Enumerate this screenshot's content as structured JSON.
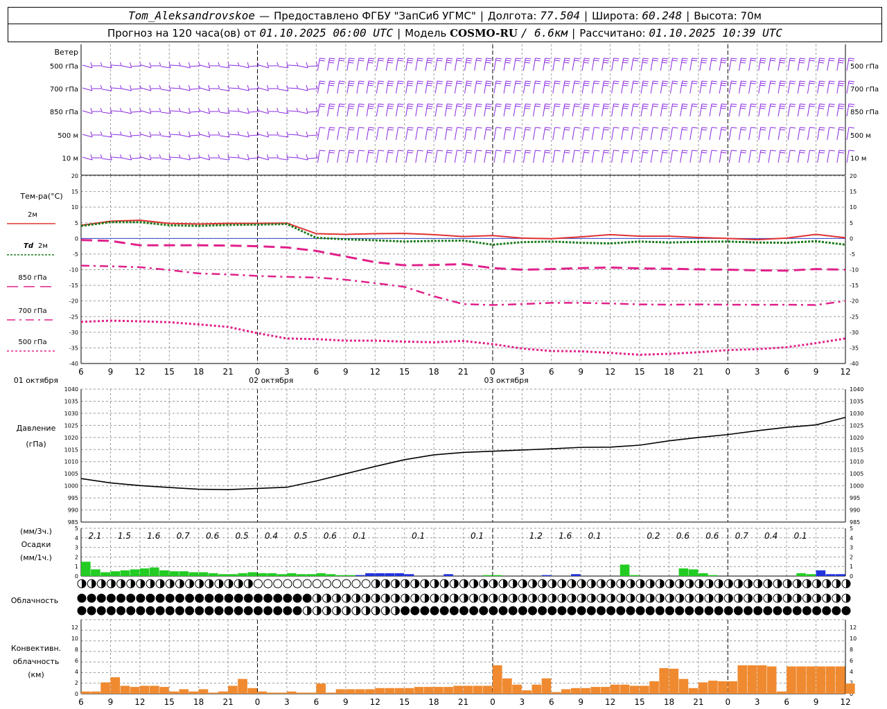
{
  "header": {
    "station": "Tom_Aleksandrovskoe",
    "dash": "—",
    "provider": "Предоставлено ФГБУ \"ЗапСиб УГМС\"",
    "lon_label": "Долгота:",
    "lon_value": "77.504",
    "lat_label": "Широта:",
    "lat_value": "60.248",
    "alt_label": "Высота:",
    "alt_value": "70м",
    "forecast_prefix": "Прогноз на 120 часа(ов) от",
    "forecast_time": "01.10.2025 06:00 UTC",
    "model_label": "Модель",
    "model_name": "COSMO-RU",
    "model_res": "/ 6.6км",
    "calc_label": "Рассчитано:",
    "calc_time": "01.10.2025 10:39 UTC"
  },
  "wind_panel": {
    "title": "Ветер",
    "levels": [
      "500 гПа",
      "700 гПа",
      "850 гПа",
      "500 м",
      "10 м"
    ],
    "barb_color": "#8a2be2"
  },
  "temp_panel": {
    "title": "Тем-ра(°C)",
    "legend": [
      {
        "label": "2м",
        "color": "#e03030",
        "dash": ""
      },
      {
        "label_italic": "Td",
        "label": "2м",
        "color": "#1a7a1a",
        "dash": "3,2"
      },
      {
        "label": "850 гПа",
        "color": "#e0208a",
        "dash": "16,8"
      },
      {
        "label": "700 гПа",
        "color": "#e0208a",
        "dash": "12,6,3,6"
      },
      {
        "label": "500 гПа",
        "color": "#e0208a",
        "dash": "3,3"
      }
    ],
    "y_ticks": [
      20,
      15,
      10,
      5,
      0,
      -5,
      -10,
      -15,
      -20,
      -25,
      -30,
      -35,
      -40
    ]
  },
  "time_axis": {
    "hour_labels": [
      "6",
      "9",
      "12",
      "15",
      "18",
      "21",
      "0",
      "3",
      "6",
      "9",
      "12",
      "15",
      "18",
      "21",
      "0",
      "3",
      "6",
      "9",
      "12",
      "15",
      "18",
      "21",
      "0",
      "3",
      "6",
      "9",
      "12"
    ],
    "dates": [
      "01 октября",
      "02 октября",
      "03 октября"
    ]
  },
  "pressure_panel": {
    "title": "Давление",
    "unit": "(гПа)",
    "y_ticks": [
      1040,
      1035,
      1030,
      1025,
      1020,
      1015,
      1010,
      1005,
      1000,
      995,
      990,
      985
    ],
    "color": "#000000"
  },
  "precip_panel": {
    "unit_top": "(мм/3ч.)",
    "title": "Осадки",
    "unit_bottom": "(мм/1ч.)",
    "y_ticks": [
      5,
      4,
      3,
      2,
      1,
      0
    ],
    "amounts_3h": [
      "2.1",
      "1.5",
      "1.6",
      "0.7",
      "0.6",
      "0.5",
      "0.4",
      "0.5",
      "0.6",
      "0.1",
      "0.1",
      "0.1",
      "1.2",
      "1.6",
      "0.1",
      "0.2",
      "0.6",
      "0.6",
      "0.7",
      "0.4",
      "0.1"
    ],
    "rain_color": "#22cc22",
    "snow_color": "#2233dd"
  },
  "cloud_panel": {
    "title": "Облачность"
  },
  "conv_panel": {
    "title1": "Конвективн.",
    "title2": "облачность",
    "unit": "(км)",
    "y_ticks": [
      12,
      10,
      8,
      6,
      4,
      2,
      0
    ],
    "color": "#f08a30"
  },
  "chart_data": [
    {
      "type": "line",
      "title": "Тем-ра(°C)",
      "x_hours": [
        0,
        3,
        6,
        9,
        12,
        15,
        18,
        21,
        24,
        27,
        30,
        33,
        36,
        39,
        42,
        45,
        48,
        51,
        54,
        57,
        60,
        63,
        66,
        69,
        72,
        75,
        78
      ],
      "ylim": [
        -40,
        20
      ],
      "series": [
        {
          "name": "2м",
          "values": [
            4.2,
            5.5,
            5.8,
            4.8,
            4.6,
            4.8,
            4.8,
            4.9,
            1.5,
            1.3,
            1.5,
            1.6,
            1.2,
            0.6,
            0.9,
            0.1,
            -0.1,
            0.5,
            1.2,
            0.7,
            0.7,
            0.3,
            0.0,
            -0.4,
            0.1,
            1.3,
            0.2
          ]
        },
        {
          "name": "Td 2м",
          "values": [
            4.0,
            5.2,
            5.2,
            4.2,
            4.0,
            4.3,
            4.4,
            4.6,
            0.2,
            -0.3,
            -0.6,
            -1.0,
            -0.8,
            -0.7,
            -2.0,
            -1.2,
            -1.0,
            -1.4,
            -1.6,
            -1.0,
            -1.3,
            -1.1,
            -1.0,
            -1.3,
            -1.4,
            -0.9,
            -2.0
          ]
        },
        {
          "name": "850 гПа",
          "values": [
            -0.5,
            -0.8,
            -2.2,
            -2.2,
            -2.2,
            -2.3,
            -2.5,
            -2.9,
            -4.0,
            -5.8,
            -7.6,
            -8.6,
            -8.5,
            -8.2,
            -9.5,
            -10.0,
            -9.8,
            -9.5,
            -9.3,
            -9.6,
            -9.7,
            -9.9,
            -10.0,
            -10.2,
            -10.3,
            -9.8,
            -10.0
          ]
        },
        {
          "name": "700 гПа",
          "values": [
            -8.7,
            -8.9,
            -9.2,
            -10.1,
            -11.2,
            -11.5,
            -12.0,
            -12.3,
            -12.5,
            -13.2,
            -14.3,
            -15.5,
            -18.5,
            -21.0,
            -21.3,
            -21.0,
            -20.6,
            -20.6,
            -20.8,
            -21.1,
            -21.2,
            -21.1,
            -21.2,
            -21.2,
            -21.2,
            -21.3,
            -20.0
          ]
        },
        {
          "name": "500 гПа",
          "values": [
            -26.7,
            -26.3,
            -26.5,
            -26.8,
            -27.5,
            -28.3,
            -30.3,
            -32.0,
            -32.2,
            -32.7,
            -32.7,
            -33.0,
            -33.2,
            -32.8,
            -33.8,
            -35.2,
            -36.0,
            -36.1,
            -36.6,
            -37.2,
            -36.9,
            -36.4,
            -35.7,
            -35.4,
            -34.8,
            -33.5,
            -32.0
          ]
        }
      ]
    },
    {
      "type": "line",
      "title": "Давление",
      "ylabel": "(гПа)",
      "x_hours": [
        0,
        3,
        6,
        9,
        12,
        15,
        18,
        21,
        24,
        27,
        30,
        33,
        36,
        39,
        42,
        45,
        48,
        51,
        54,
        57,
        60,
        63,
        66,
        69,
        72,
        75,
        78
      ],
      "ylim": [
        985,
        1040
      ],
      "series": [
        {
          "name": "Давление",
          "values": [
            1003.0,
            1001.2,
            1000.1,
            999.3,
            998.6,
            998.4,
            998.9,
            999.4,
            1002.0,
            1005.0,
            1008.0,
            1010.8,
            1012.8,
            1013.8,
            1014.3,
            1014.8,
            1015.3,
            1015.9,
            1016.0,
            1016.8,
            1018.6,
            1020.0,
            1021.2,
            1022.8,
            1024.2,
            1025.2,
            1028.3
          ]
        }
      ]
    },
    {
      "type": "bar",
      "title": "Осадки",
      "ylabel": "(мм/1ч.)",
      "ylim": [
        0,
        5
      ],
      "x_hours": [
        0,
        1,
        2,
        3,
        4,
        5,
        6,
        7,
        8,
        9,
        10,
        11,
        12,
        13,
        14,
        15,
        16,
        17,
        18,
        19,
        20,
        21,
        22,
        23,
        24,
        25,
        26,
        27,
        28,
        29,
        30,
        31,
        32,
        33,
        34,
        35,
        36,
        37,
        38,
        39,
        40,
        41,
        42,
        43,
        44,
        45,
        46,
        47,
        48,
        49,
        50,
        51,
        52,
        53,
        54,
        55,
        56,
        57,
        58,
        59,
        60,
        61,
        62,
        63,
        64,
        65,
        66,
        67,
        68,
        69,
        70,
        71,
        72,
        73,
        74,
        75,
        76,
        77,
        78
      ],
      "series": [
        {
          "name": "rain",
          "values": [
            1.5,
            0.7,
            0.4,
            0.5,
            0.6,
            0.7,
            0.8,
            0.9,
            0.6,
            0.5,
            0.5,
            0.4,
            0.4,
            0.3,
            0.2,
            0.2,
            0.3,
            0.4,
            0.3,
            0.3,
            0.2,
            0.3,
            0.2,
            0.2,
            0.3,
            0.2,
            0.1,
            0.1,
            0.1,
            0.2,
            0.2,
            0.2,
            0.2,
            0.1,
            0,
            0,
            0,
            0,
            0,
            0,
            0,
            0.1,
            0.1,
            0,
            0,
            0,
            0,
            0,
            0,
            0,
            0,
            0,
            0,
            0,
            0,
            1.2,
            0.1,
            0,
            0,
            0,
            0,
            0.8,
            0.7,
            0.3,
            0.1,
            0,
            0,
            0,
            0,
            0,
            0,
            0,
            0,
            0.3,
            0.2,
            0.1,
            0.1,
            0.1,
            0
          ]
        },
        {
          "name": "snow",
          "values": [
            0,
            0,
            0,
            0,
            0,
            0,
            0,
            0,
            0,
            0,
            0,
            0,
            0,
            0,
            0,
            0,
            0,
            0,
            0,
            0,
            0,
            0,
            0,
            0,
            0,
            0,
            0,
            0,
            0.1,
            0.3,
            0.3,
            0.3,
            0.3,
            0.2,
            0,
            0,
            0,
            0.2,
            0,
            0,
            0,
            0,
            0,
            0,
            0,
            0,
            0,
            0.1,
            0,
            0,
            0.2,
            0,
            0,
            0,
            0,
            0,
            0,
            0,
            0,
            0,
            0,
            0,
            0,
            0,
            0,
            0,
            0,
            0,
            0,
            0,
            0,
            0,
            0,
            0,
            0,
            0.6,
            0.2,
            0.2,
            0
          ]
        }
      ]
    },
    {
      "type": "bar",
      "title": "Конвективн. облачность",
      "ylabel": "(км)",
      "ylim": [
        0,
        13
      ],
      "x_hours": [
        0,
        1,
        2,
        3,
        4,
        5,
        6,
        7,
        8,
        9,
        10,
        11,
        12,
        13,
        14,
        15,
        16,
        17,
        18,
        19,
        20,
        21,
        22,
        23,
        24,
        25,
        26,
        27,
        28,
        29,
        30,
        31,
        32,
        33,
        34,
        35,
        36,
        37,
        38,
        39,
        40,
        41,
        42,
        43,
        44,
        45,
        46,
        47,
        48,
        49,
        50,
        51,
        52,
        53,
        54,
        55,
        56,
        57,
        58,
        59,
        60,
        61,
        62,
        63,
        64,
        65,
        66,
        67,
        68,
        69,
        70,
        71,
        72,
        73,
        74,
        75,
        76,
        77,
        78
      ],
      "series": [
        {
          "name": "top",
          "values": [
            0.4,
            0.4,
            2.0,
            2.9,
            1.4,
            1.2,
            1.4,
            1.4,
            1.2,
            0.4,
            0.8,
            0.4,
            0.8,
            0.2,
            0.4,
            1.4,
            2.6,
            1.0,
            0.4,
            0.2,
            0.2,
            0.4,
            0.2,
            0.2,
            1.8,
            0.2,
            0.8,
            0.8,
            0.8,
            0.8,
            1.0,
            1.0,
            1.0,
            1.0,
            1.2,
            1.2,
            1.2,
            1.2,
            1.4,
            1.4,
            1.4,
            1.4,
            5.0,
            2.7,
            1.6,
            0.6,
            1.6,
            2.7,
            0.3,
            0.8,
            1.0,
            1.0,
            1.2,
            1.2,
            1.6,
            1.6,
            1.4,
            1.4,
            2.2,
            4.5,
            4.4,
            2.6,
            1.0,
            2.0,
            2.3,
            2.2,
            2.2,
            5.0,
            5.0,
            5.0,
            4.8,
            0.4,
            4.8,
            4.8,
            4.8,
            4.8,
            4.8,
            4.8,
            1.8
          ]
        }
      ]
    }
  ]
}
